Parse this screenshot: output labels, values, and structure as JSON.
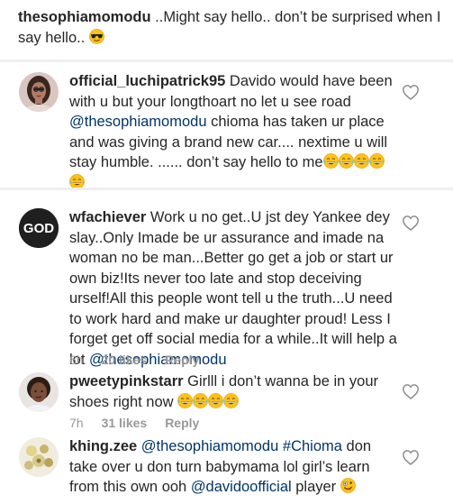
{
  "top_comment": {
    "username": "thesophiamomodu",
    "text": " ..Might say hello.. don’t be surprised when I say hello.. "
  },
  "comments": [
    {
      "username": "official_luchipatrick95",
      "text_a": " Davido would have been with u but your longthoart no let u see road ",
      "mention_1": "@thesophiamomodu",
      "text_b": " chioma has taken ur place and was giving a brand new car.... nextime u will stay humble. ...... don’t say hello to me"
    },
    {
      "username": "wfachiever",
      "avatar_text": "GOD",
      "text_a": " Work u no get..U jst dey Yankee dey slay..Only Imade be ur assurance and imade na woman no be man...Better go get a job or start ur own biz!Its never too late and stop deceiving urself!All this people wont tell u the truth...U need to work hard and make ur daughter proud! Less I forget get off social media for a while..It will help a lot ",
      "mention_1": "@thesophiamomodu",
      "time": "6h",
      "likes": "20 likes",
      "reply": "Reply"
    },
    {
      "username": "pweetypinkstarr",
      "text_a": " Girlll i don’t wanna be in your shoes right now ",
      "time": "7h",
      "likes": "31 likes",
      "reply": "Reply"
    },
    {
      "username": "khing.zee",
      "mention_1": "@thesophiamomodu",
      "mention_2": "#Chioma",
      "text_a": " don take over u don turn babymama lol  girl’s learn from this own ooh ",
      "mention_3": "@davidoofficial",
      "text_b": " player "
    }
  ],
  "icons": {
    "heart": "heart-outline-icon",
    "laugh": "tears-of-joy-emoji",
    "cool": "sunglasses-emoji",
    "crazy": "zany-face-emoji"
  },
  "colors": {
    "mention": "#003569",
    "meta": "#999999",
    "text": "#262626",
    "separator": "#efefef"
  }
}
